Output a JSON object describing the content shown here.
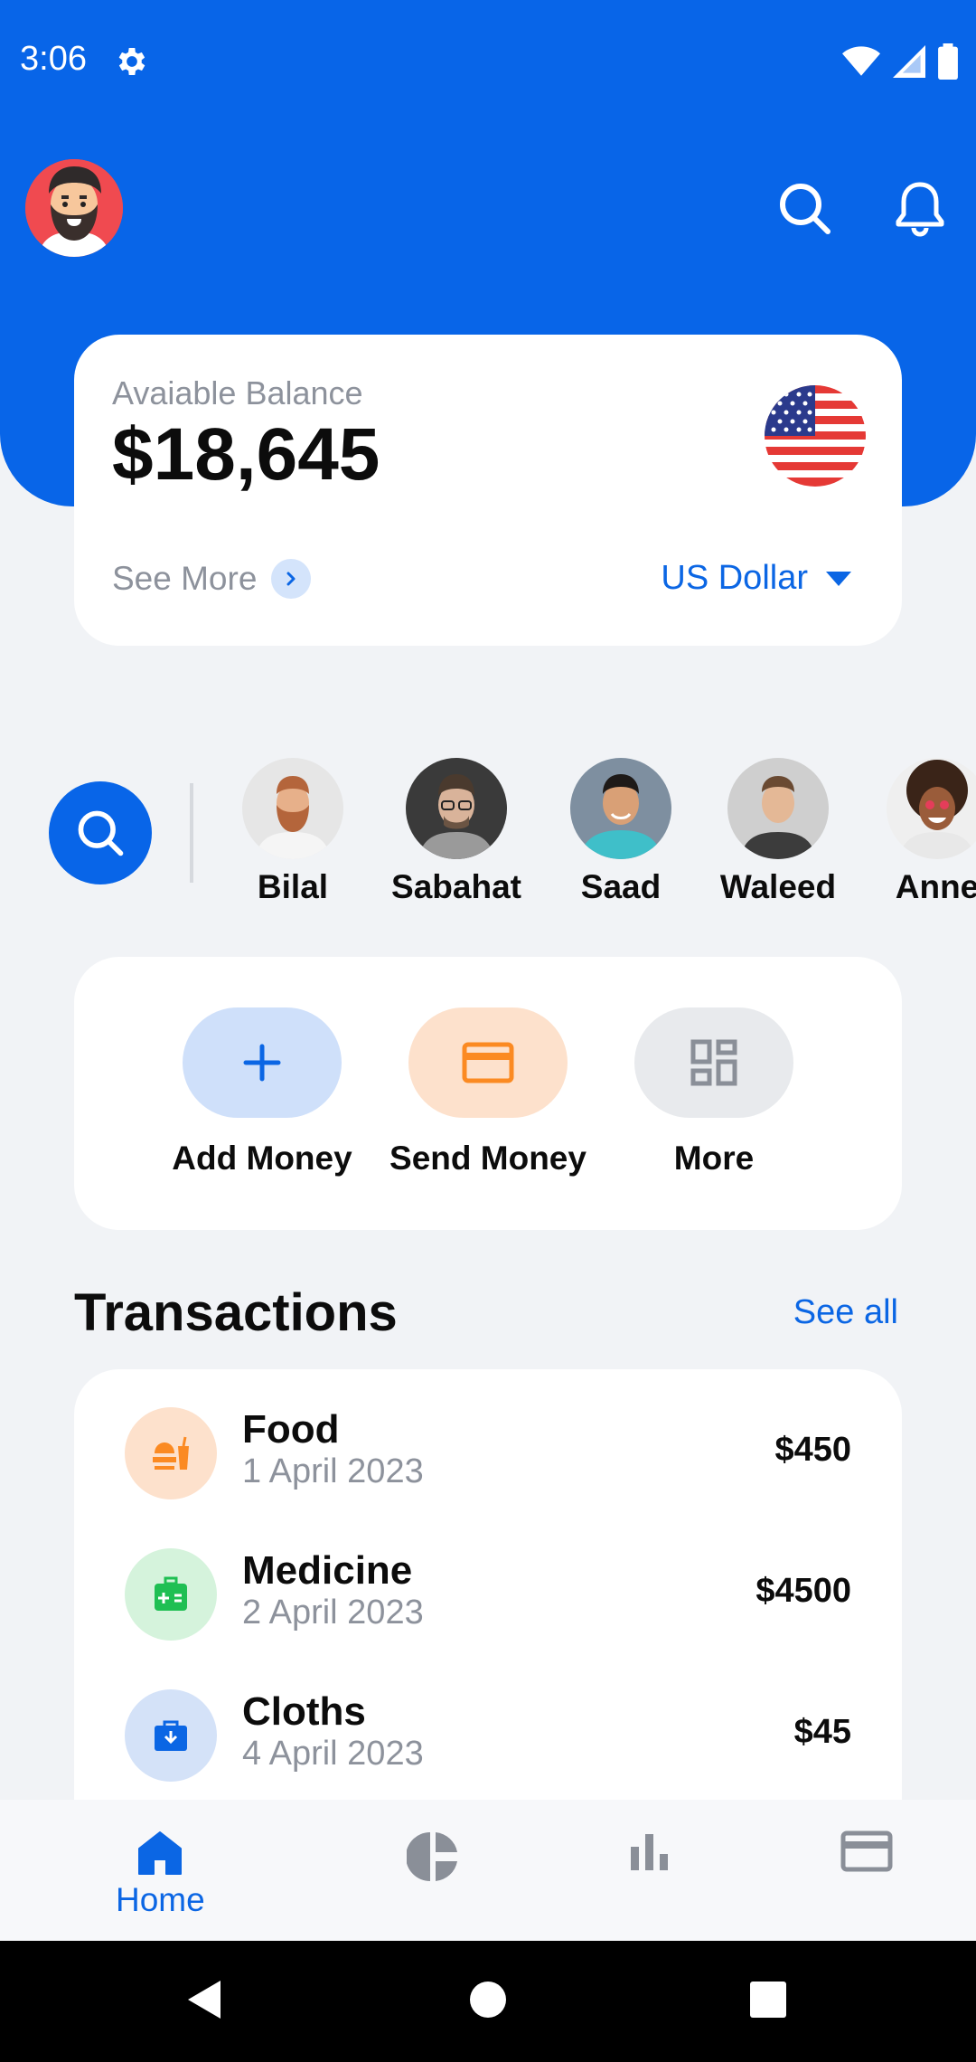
{
  "status_bar": {
    "time": "3:06",
    "icons": [
      "settings-gear-icon",
      "wifi-icon",
      "signal-icon",
      "battery-icon"
    ]
  },
  "header": {
    "avatar": "bearded-man-avatar",
    "icons": [
      "search-icon",
      "bell-icon"
    ],
    "background_color": "#0865e8"
  },
  "balance": {
    "label": "Avaiable Balance",
    "amount": "$18,645",
    "see_more": "See More",
    "currency": "US Dollar",
    "flag": "us-flag-icon"
  },
  "contacts": {
    "search_icon": "search-icon",
    "people": [
      {
        "name": "Bilal"
      },
      {
        "name": "Sabahat"
      },
      {
        "name": "Saad"
      },
      {
        "name": "Waleed"
      },
      {
        "name": "Anne"
      }
    ]
  },
  "actions": [
    {
      "label": "Add Money",
      "icon": "plus-icon",
      "color": "#cfe0fa",
      "icon_color": "#0b66e4"
    },
    {
      "label": "Send Money",
      "icon": "card-icon",
      "color": "#fde1cc",
      "icon_color": "#fb8a22"
    },
    {
      "label": "More",
      "icon": "grid-icon",
      "color": "#e8eaed",
      "icon_color": "#8a8f98"
    }
  ],
  "transactions": {
    "title": "Transactions",
    "see_all": "See all",
    "items": [
      {
        "name": "Food",
        "date": "1 April 2023",
        "amount": "$450",
        "icon": "food-icon",
        "color": "#fde1cc"
      },
      {
        "name": "Medicine",
        "date": "2 April 2023",
        "amount": "$4500",
        "icon": "medicine-icon",
        "color": "#d5f3dc"
      },
      {
        "name": "Cloths",
        "date": "4 April 2023",
        "amount": "$45",
        "icon": "shopping-bag-icon",
        "color": "#d4e2f8"
      }
    ]
  },
  "bottom_nav": {
    "items": [
      {
        "label": "Home",
        "icon": "home-icon",
        "active": true
      },
      {
        "label": "",
        "icon": "pie-chart-icon",
        "active": false
      },
      {
        "label": "",
        "icon": "bar-chart-icon",
        "active": false
      },
      {
        "label": "",
        "icon": "card-icon",
        "active": false
      }
    ],
    "active_color": "#0b66e4"
  },
  "system_nav": [
    "back-icon",
    "home-circle-icon",
    "recents-icon"
  ]
}
